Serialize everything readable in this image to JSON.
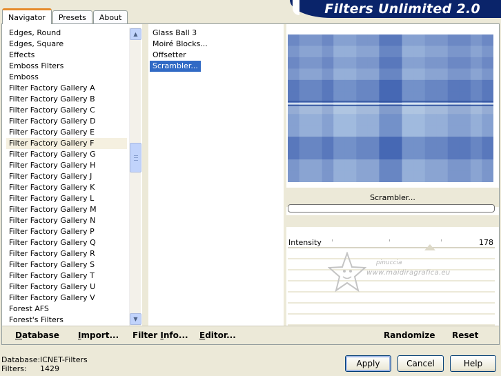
{
  "tabs": [
    "Navigator",
    "Presets",
    "About"
  ],
  "banner_title": "Filters Unlimited 2.0",
  "categories": [
    "Edges, Round",
    "Edges, Square",
    "Effects",
    "Emboss Filters",
    "Emboss",
    "Filter Factory Gallery A",
    "Filter Factory Gallery B",
    "Filter Factory Gallery C",
    "Filter Factory Gallery D",
    "Filter Factory Gallery E",
    "Filter Factory Gallery F",
    "Filter Factory Gallery G",
    "Filter Factory Gallery H",
    "Filter Factory Gallery J",
    "Filter Factory Gallery K",
    "Filter Factory Gallery L",
    "Filter Factory Gallery M",
    "Filter Factory Gallery N",
    "Filter Factory Gallery P",
    "Filter Factory Gallery Q",
    "Filter Factory Gallery R",
    "Filter Factory Gallery S",
    "Filter Factory Gallery T",
    "Filter Factory Gallery U",
    "Filter Factory Gallery V",
    "Forest AFS",
    "Forest's Filters"
  ],
  "selected_category": "Filter Factory Gallery F",
  "filters": [
    "Glass Ball 3",
    "Moiré Blocks...",
    "Offsetter",
    "Scrambler..."
  ],
  "selected_filter": "Scrambler...",
  "preview_filter_name": "Scrambler...",
  "params": [
    {
      "label": "Intensity",
      "value": "178"
    }
  ],
  "watermark": {
    "line1": "pinuccia",
    "line2": "www.maidiragrafica.eu"
  },
  "bottom_actions": {
    "database": {
      "under": "D",
      "rest": "atabase"
    },
    "import": {
      "under": "I",
      "rest": "mport..."
    },
    "filter_info": {
      "pre": "Filter ",
      "under": "I",
      "rest": "nfo..."
    },
    "editor": {
      "under": "E",
      "rest": "ditor..."
    },
    "randomize": "Randomize",
    "reset": "Reset"
  },
  "status": {
    "database_label": "Database:",
    "database_value": "ICNET-Filters",
    "filters_label": "Filters:",
    "filters_value": "1429"
  },
  "dialog_buttons": {
    "apply": "Apply",
    "cancel": "Cancel",
    "help": "Help"
  },
  "colors": {
    "selection": "#316ac5",
    "banner": "#0a246a",
    "accent_tab": "#e68b2c"
  }
}
